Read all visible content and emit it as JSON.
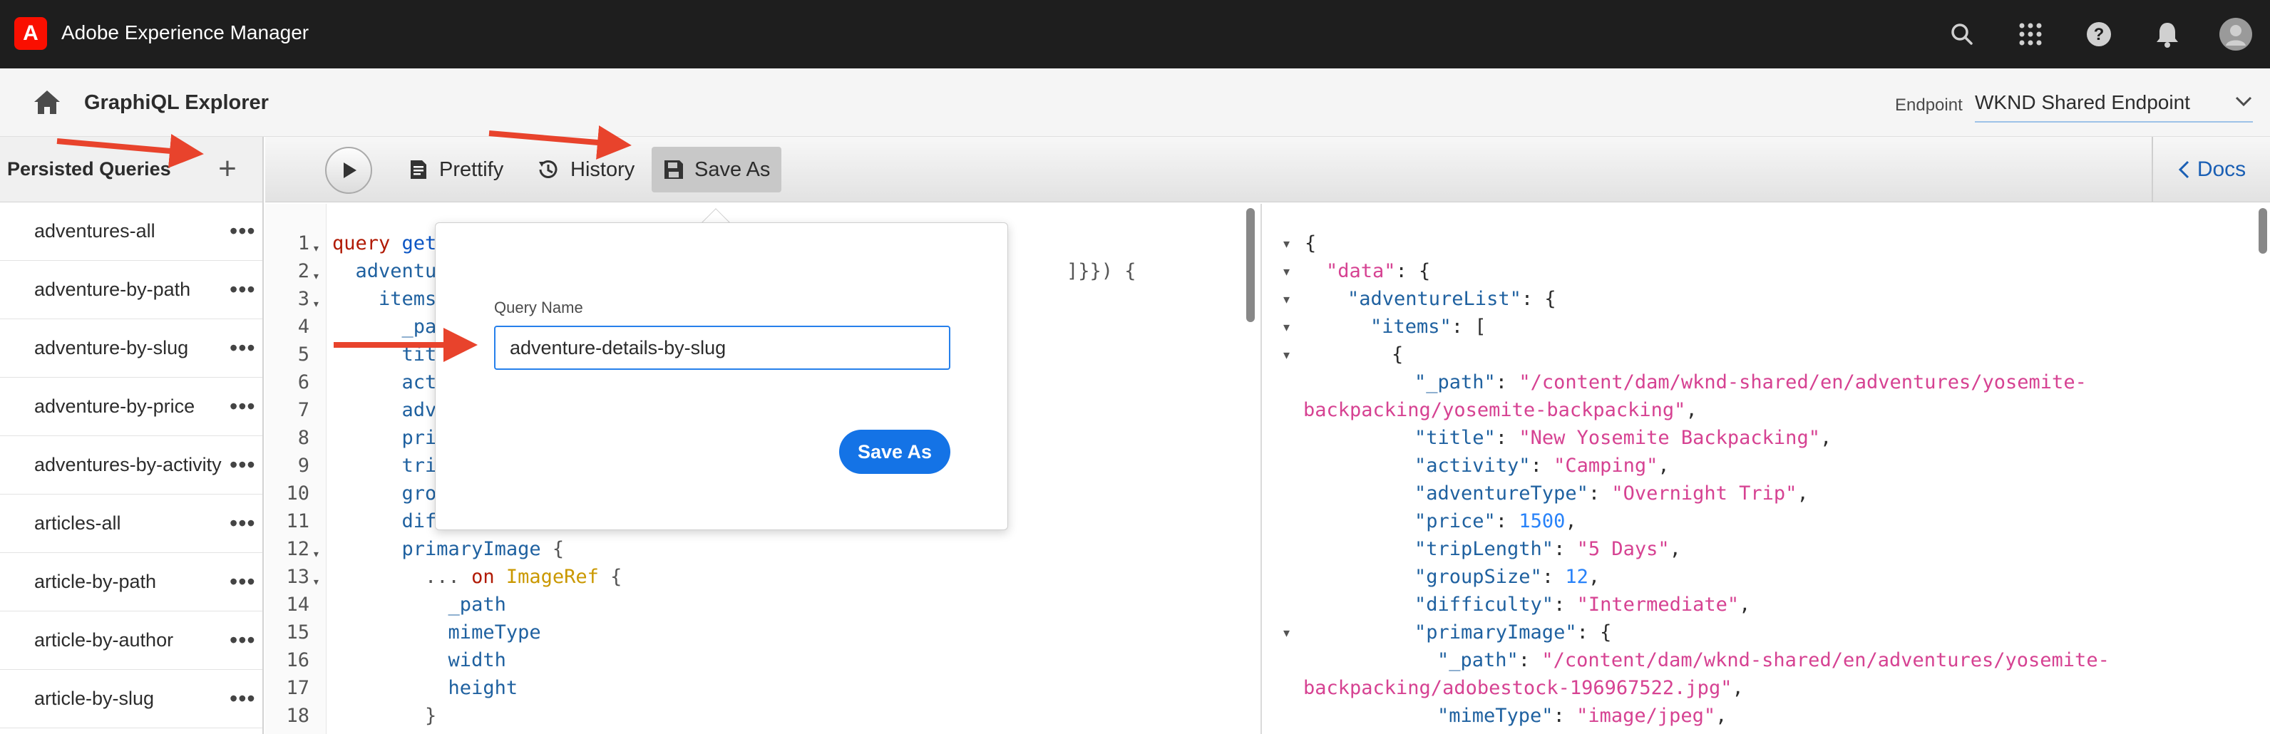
{
  "shell": {
    "app_title": "Adobe Experience Manager",
    "logo_letter": "A",
    "icons": [
      "search-icon",
      "apps-grid-icon",
      "help-icon",
      "notifications-icon",
      "user-avatar"
    ]
  },
  "header": {
    "title": "GraphiQL Explorer",
    "endpoint_label": "Endpoint",
    "endpoint_value": "WKND Shared Endpoint"
  },
  "sidebar": {
    "title": "Persisted Queries",
    "add_label": "+",
    "more_label": "•••",
    "items": [
      {
        "label": "adventures-all"
      },
      {
        "label": "adventure-by-path"
      },
      {
        "label": "adventure-by-slug"
      },
      {
        "label": "adventure-by-price"
      },
      {
        "label": "adventures-by-activity"
      },
      {
        "label": "articles-all"
      },
      {
        "label": "article-by-path"
      },
      {
        "label": "article-by-author"
      },
      {
        "label": "article-by-slug"
      }
    ]
  },
  "toolbar": {
    "prettify": "Prettify",
    "history": "History",
    "save_as": "Save As",
    "docs": "Docs"
  },
  "popover": {
    "query_name_label": "Query Name",
    "query_name_value": "adventure-details-by-slug",
    "save_button": "Save As"
  },
  "editor": {
    "line_numbers": [
      "1",
      "2",
      "3",
      "4",
      "5",
      "6",
      "7",
      "8",
      "9",
      "10",
      "11",
      "12",
      "13",
      "14",
      "15",
      "16",
      "17",
      "18"
    ],
    "fragments": {
      "l1_kw": "query ",
      "l1_fn": "getA",
      "l2_fd": "  adventu",
      "l2_tail": "]}}) {",
      "l3_fd": "    items",
      "l4_fd": "      _pa",
      "l5_fd": "      tit",
      "l6_fd": "      act",
      "l7_fd": "      adv",
      "l8_fd": "      pri",
      "l9_fd": "      tri",
      "l10_fd": "      gro",
      "l11_fd": "      diffi",
      "l12_fd": "      primaryImage",
      "l12_p": " {",
      "l13_p": "        ... ",
      "l13_kw": "on ",
      "l13_ty": "ImageRef",
      "l13_b": " {",
      "l14_fd": "          _path",
      "l15_fd": "          mimeType",
      "l16_fd": "          width",
      "l17_fd": "          height",
      "l18_p": "        }"
    }
  },
  "result": {
    "l1": "{",
    "l2_k": "\"data\"",
    "l2_p": ": {",
    "l3_k": "\"adventureList\"",
    "l3_p": ": {",
    "l4_k": "\"items\"",
    "l4_p": ": [",
    "l5": "{",
    "l6_k": "\"_path\"",
    "l6_s": "\"/content/dam/wknd-shared/en/adventures/yosemite-",
    "l7_s": "backpacking/yosemite-backpacking\"",
    "l8_k": "\"title\"",
    "l8_s": "\"New Yosemite Backpacking\"",
    "l9_k": "\"activity\"",
    "l9_s": "\"Camping\"",
    "l10_k": "\"adventureType\"",
    "l10_s": "\"Overnight Trip\"",
    "l11_k": "\"price\"",
    "l11_n": "1500",
    "l12_k": "\"tripLength\"",
    "l12_s": "\"5 Days\"",
    "l13_k": "\"groupSize\"",
    "l13_n": "12",
    "l14_k": "\"difficulty\"",
    "l14_s": "\"Intermediate\"",
    "l15_k": "\"primaryImage\"",
    "l15_p": ": {",
    "l16_k": "\"_path\"",
    "l16_s": "\"/content/dam/wknd-shared/en/adventures/yosemite-",
    "l17_s": "backpacking/adobestock-196967522.jpg\"",
    "l18_k": "\"mimeType\"",
    "l18_s": "\"image/jpeg\""
  },
  "colors": {
    "accent": "#1473e6",
    "annotation_arrow": "#e8432c",
    "shell_bg": "#1e1e1e"
  }
}
